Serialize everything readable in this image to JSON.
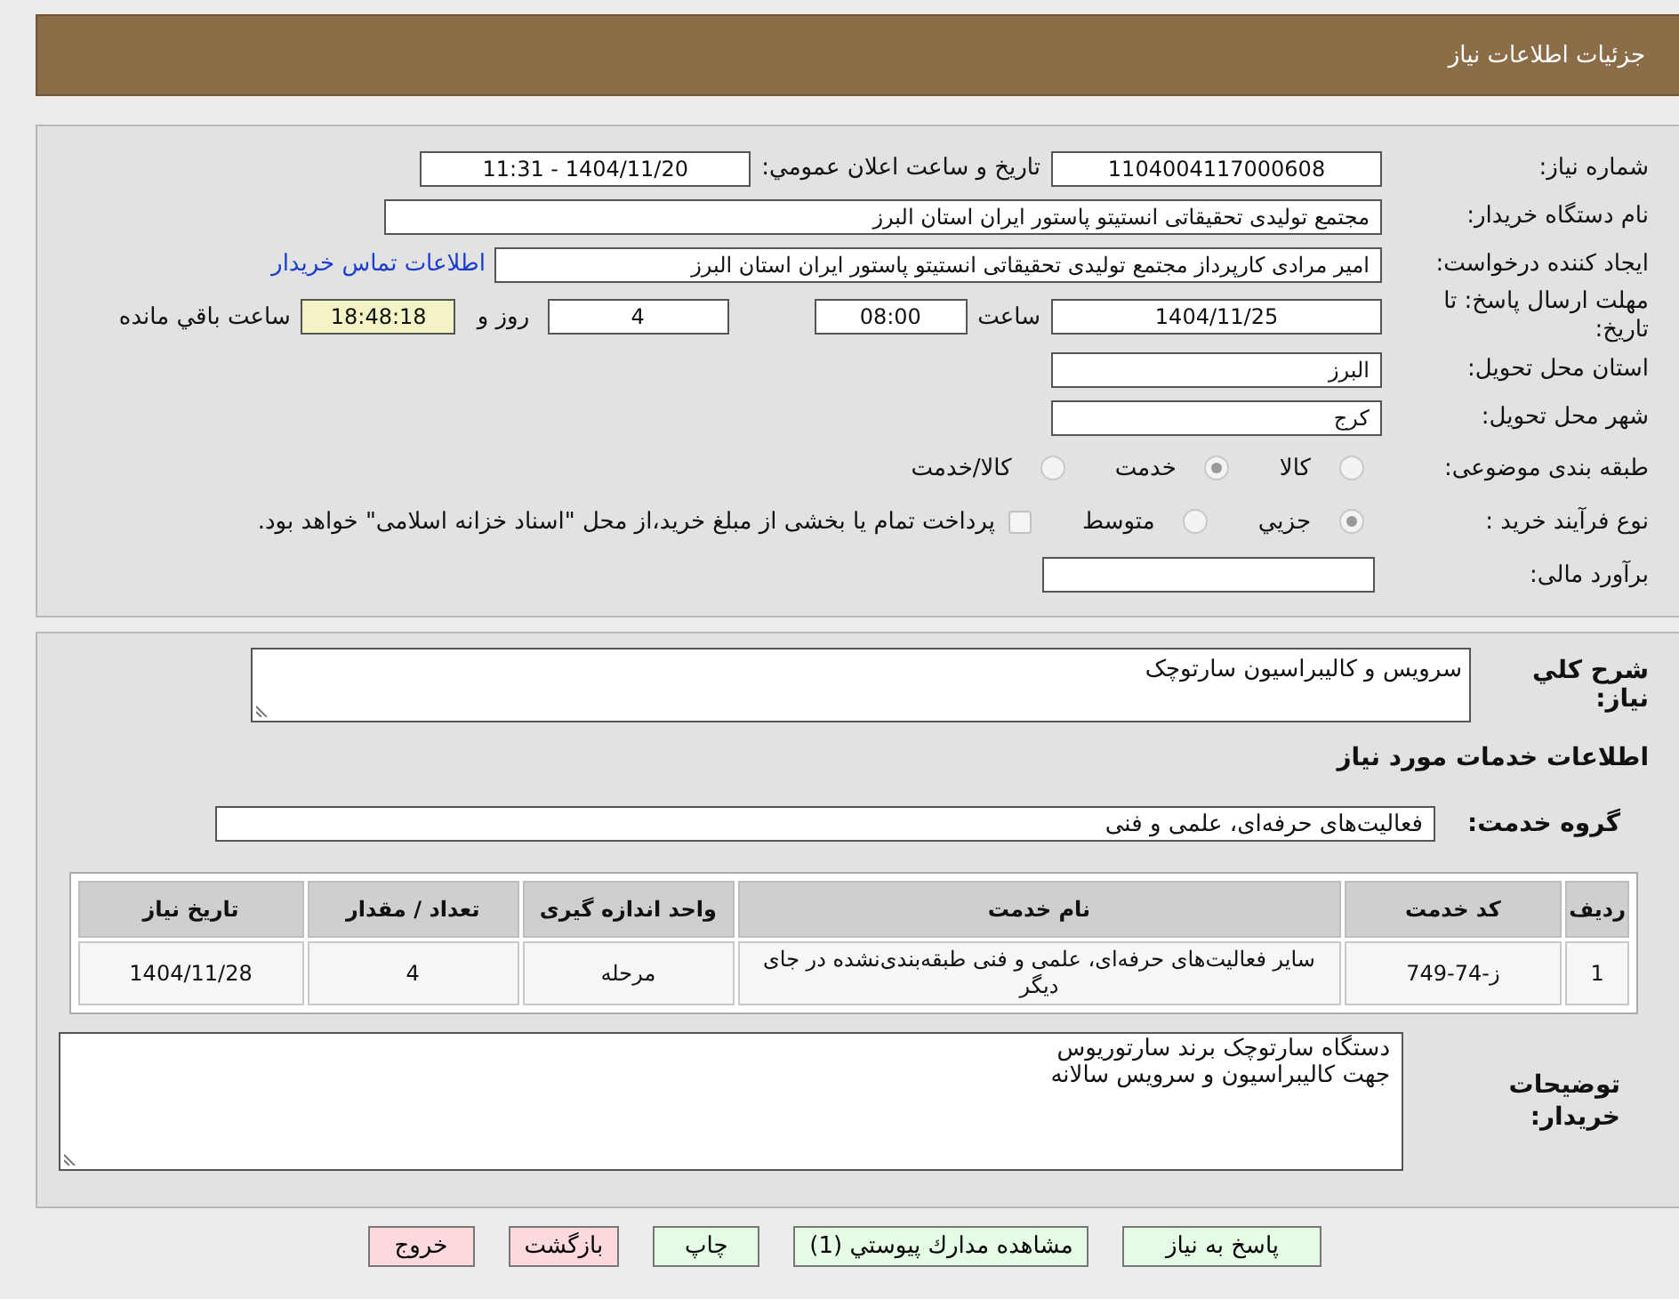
{
  "header": {
    "title": "جزئيات اطلاعات نياز"
  },
  "general": {
    "need_number": {
      "label": "شماره نياز:",
      "value": "1104004117000608"
    },
    "announce_date": {
      "label": "تاريخ و ساعت اعلان عمومي:",
      "value": "1404/11/20 - 11:31"
    },
    "buyer_org": {
      "label": "نام دستگاه خريدار:",
      "value": "مجتمع توليدی تحقيقاتی انستيتو پاستور ايران استان البرز"
    },
    "requester": {
      "label": "ايجاد كننده درخواست:",
      "value": "امير مرادی كارپرداز مجتمع توليدی تحقيقاتی انستيتو پاستور ايران استان البرز",
      "link": "اطلاعات تماس خريدار"
    },
    "deadline": {
      "label": "مهلت ارسال پاسخ: تا تاريخ:",
      "date": "1404/11/25",
      "time_label": "ساعت",
      "time": "08:00",
      "days": "4",
      "days_label": "روز و",
      "remaining": "18:48:18",
      "remaining_label": "ساعت باقي مانده"
    },
    "province": {
      "label": "استان محل تحويل:",
      "value": "البرز"
    },
    "city": {
      "label": "شهر محل تحويل:",
      "value": "كرج"
    },
    "category": {
      "label": "طبقه بندی موضوعی:",
      "options": [
        {
          "label": "كالا",
          "selected": false
        },
        {
          "label": "خدمت",
          "selected": true
        },
        {
          "label": "كالا/خدمت",
          "selected": false
        }
      ]
    },
    "purchase_type": {
      "label": "نوع فرآيند خريد :",
      "options": [
        {
          "label": "جزيي",
          "selected": true
        },
        {
          "label": "متوسط",
          "selected": false
        }
      ],
      "treasury": {
        "label": "پرداخت تمام يا بخشی از مبلغ خريد،از محل \"اسناد خزانه اسلامی\" خواهد بود.",
        "checked": false
      }
    },
    "budget": {
      "label": "برآورد مالی:"
    }
  },
  "need": {
    "description": {
      "label": "شرح کلي نياز:",
      "value": "سرويس و كاليبراسيون سارتوچک"
    },
    "services_heading": "اطلاعات خدمات مورد نياز",
    "service_group": {
      "label": "گروه خدمت:",
      "value": "فعاليت‌های حرفه‌ای، علمی و فنی"
    },
    "table": {
      "columns": [
        "رديف",
        "كد خدمت",
        "نام خدمت",
        "واحد اندازه گيری",
        "تعداد / مقدار",
        "تاريخ نياز"
      ],
      "rows": [
        [
          "1",
          "ز-74-749",
          "ساير فعاليت‌های حرفه‌ای، علمی و فنی طبقه‌بندی‌نشده در جای ديگر",
          "مرحله",
          "4",
          "1404/11/28"
        ]
      ]
    },
    "buyer_notes": {
      "label": "توضيحات خريدار:",
      "lines": [
        "دستگاه سارتوچک برند سارتوريوس",
        "جهت كاليبراسيون و سرويس سالانه"
      ]
    }
  },
  "buttons": [
    {
      "label": "پاسخ به نياز",
      "kind": "action"
    },
    {
      "label": "مشاهده مدارك پيوستي (1)",
      "kind": "action"
    },
    {
      "label": "چاپ",
      "kind": "action"
    },
    {
      "label": "بازگشت",
      "kind": "exit"
    },
    {
      "label": "خروج",
      "kind": "exit"
    }
  ]
}
